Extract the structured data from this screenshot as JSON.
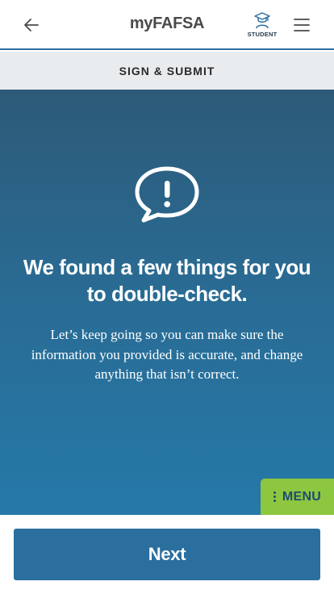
{
  "header": {
    "app_title": "myFAFSA",
    "student_label": "STUDENT",
    "icons": {
      "back": "arrow-left-icon",
      "student": "graduation-cap-student-icon",
      "menu": "hamburger-menu-icon"
    }
  },
  "section": {
    "title": "SIGN & SUBMIT"
  },
  "main": {
    "icon": "speech-bubble-exclamation-icon",
    "heading": "We found a few things for you to double-check.",
    "body": "Let’s keep going so you can make sure the information you provided is accurate, and change anything that isn’t correct."
  },
  "menu_button": {
    "label": "MENU",
    "icon": "vertical-dots-icon"
  },
  "footer": {
    "next_label": "Next"
  },
  "colors": {
    "header_underline": "#2a6f9e",
    "section_bar_bg": "#e8ecef",
    "main_gradient_top": "#2d5a78",
    "main_gradient_bottom": "#2579a8",
    "menu_bg": "#8dc63f",
    "next_bg": "#2a6f9e"
  }
}
